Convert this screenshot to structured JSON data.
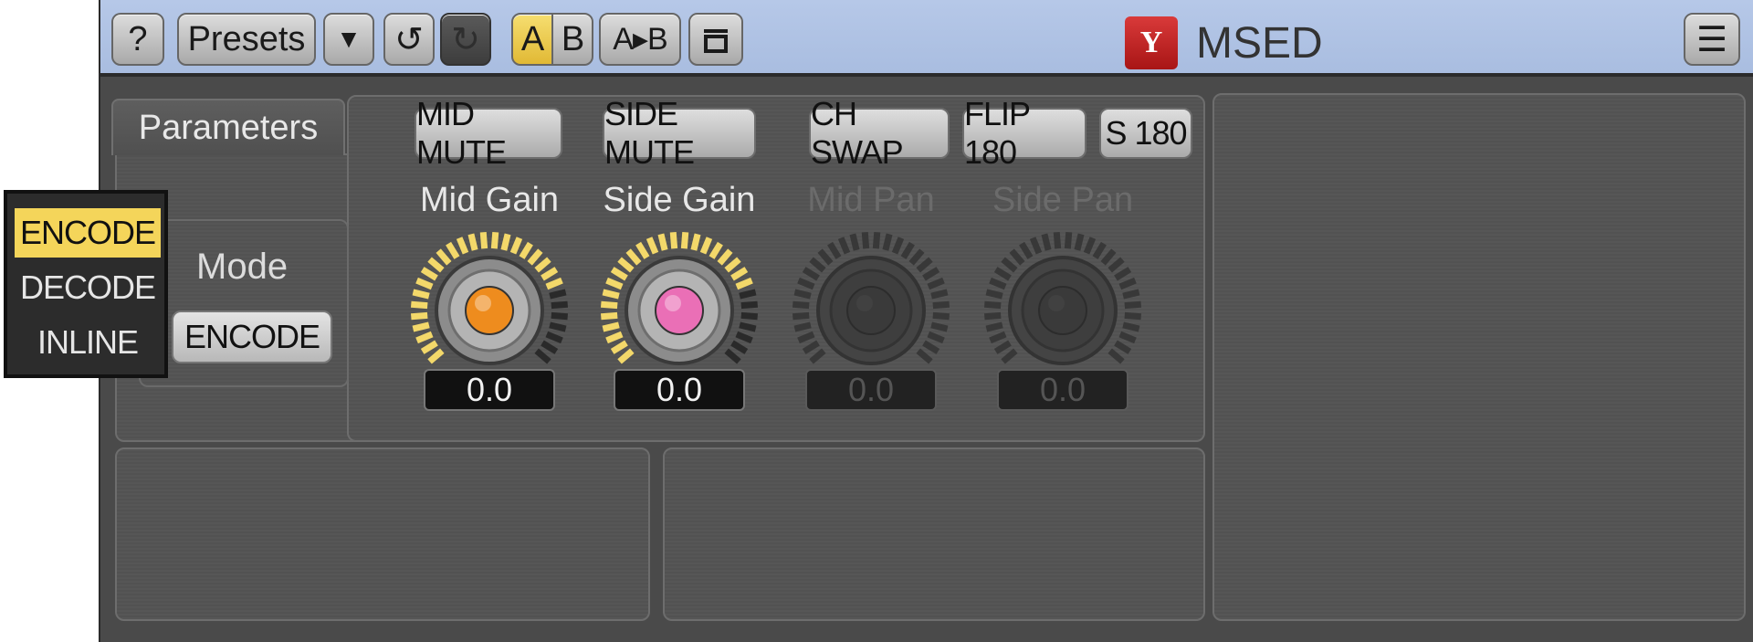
{
  "toolbar": {
    "help_label": "?",
    "presets_label": "Presets",
    "dropdown_glyph": "▼",
    "undo_glyph": "↺",
    "redo_glyph": "↻",
    "a_label": "A",
    "b_label": "B",
    "copy_ab_label": "A▸B",
    "window_glyph": "⊓",
    "menu_glyph": "☰",
    "logo_text": "Y",
    "title": "MSED",
    "colors": {
      "bar": "#b0c4e4",
      "active": "#f0d050",
      "logo": "#c82020"
    }
  },
  "parameters": {
    "tab_label": "Parameters",
    "mode": {
      "label": "Mode",
      "value": "ENCODE",
      "options": [
        "ENCODE",
        "DECODE",
        "INLINE"
      ]
    },
    "buttons": {
      "mid_mute": "MID MUTE",
      "side_mute": "SIDE MUTE",
      "ch_swap": "CH SWAP",
      "flip180": "FLIP 180",
      "s180": "S 180"
    },
    "knobs": [
      {
        "label": "Mid Gain",
        "value": "0.0",
        "cap_color": "#ee8c1e",
        "enabled": true,
        "level": 0.75
      },
      {
        "label": "Side Gain",
        "value": "0.0",
        "cap_color": "#ea6fb6",
        "enabled": true,
        "level": 0.75
      },
      {
        "label": "Mid Pan",
        "value": "0.0",
        "cap_color": "#3a3a3a",
        "enabled": false,
        "level": 0.5
      },
      {
        "label": "Side Pan",
        "value": "0.0",
        "cap_color": "#3a3a3a",
        "enabled": false,
        "level": 0.5
      }
    ]
  }
}
